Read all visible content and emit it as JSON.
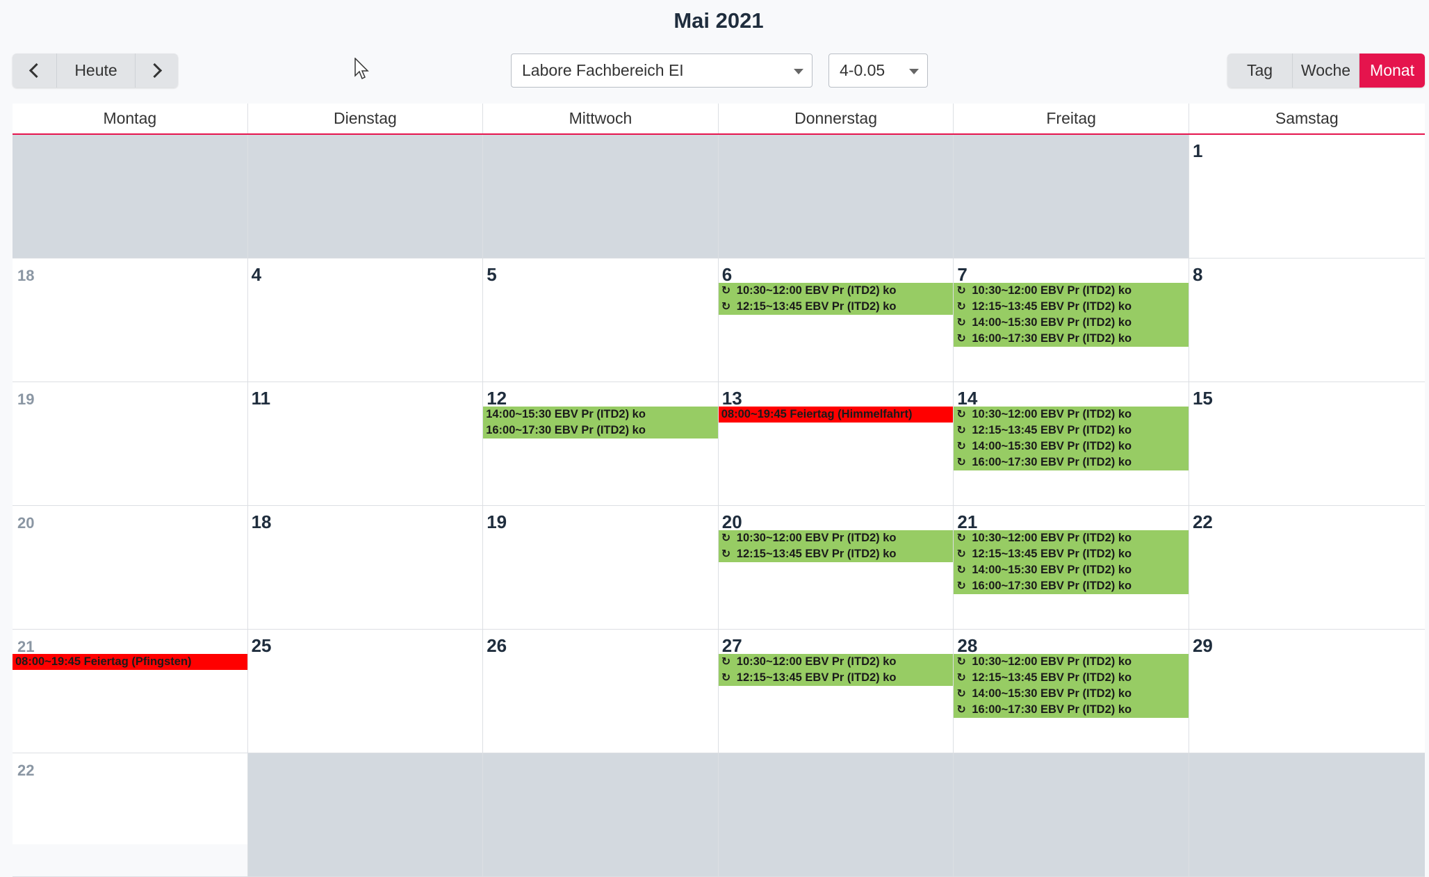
{
  "title": "Mai 2021",
  "nav": {
    "prev_icon": "chevron-left-icon",
    "today_label": "Heute",
    "next_icon": "chevron-right-icon"
  },
  "filters": {
    "group_value": "Labore Fachbereich EI",
    "room_value": "4-0.05"
  },
  "views": {
    "day": "Tag",
    "week": "Woche",
    "month": "Monat",
    "active": "Monat"
  },
  "colors": {
    "accent": "#e5144d",
    "event_green": "#97cc64",
    "event_red": "#ff0000",
    "outside_day": "#d3d9df"
  },
  "weekdays": [
    "Montag",
    "Dienstag",
    "Mittwoch",
    "Donnerstag",
    "Freitag",
    "Samstag"
  ],
  "weeks": [
    {
      "cells": [
        {
          "label": "",
          "outside": true,
          "events": []
        },
        {
          "label": "",
          "outside": true,
          "events": []
        },
        {
          "label": "",
          "outside": true,
          "events": []
        },
        {
          "label": "",
          "outside": true,
          "events": []
        },
        {
          "label": "",
          "outside": true,
          "events": []
        },
        {
          "label": "1",
          "outside": false,
          "events": []
        }
      ]
    },
    {
      "cells": [
        {
          "label": "18",
          "kw": true,
          "outside": false,
          "events": []
        },
        {
          "label": "4",
          "outside": false,
          "events": []
        },
        {
          "label": "5",
          "outside": false,
          "events": []
        },
        {
          "label": "6",
          "outside": false,
          "events": [
            {
              "text": "10:30~12:00 EBV Pr (ITD2) ko",
              "color": "green",
              "recurring": true
            },
            {
              "text": "12:15~13:45 EBV Pr (ITD2) ko",
              "color": "green",
              "recurring": true
            }
          ]
        },
        {
          "label": "7",
          "outside": false,
          "events": [
            {
              "text": "10:30~12:00 EBV Pr (ITD2) ko",
              "color": "green",
              "recurring": true
            },
            {
              "text": "12:15~13:45 EBV Pr (ITD2) ko",
              "color": "green",
              "recurring": true
            },
            {
              "text": "14:00~15:30 EBV Pr (ITD2) ko",
              "color": "green",
              "recurring": true
            },
            {
              "text": "16:00~17:30 EBV Pr (ITD2) ko",
              "color": "green",
              "recurring": true
            }
          ]
        },
        {
          "label": "8",
          "outside": false,
          "events": []
        }
      ]
    },
    {
      "cells": [
        {
          "label": "19",
          "kw": true,
          "outside": false,
          "events": []
        },
        {
          "label": "11",
          "outside": false,
          "events": []
        },
        {
          "label": "12",
          "outside": false,
          "events": [
            {
              "text": "14:00~15:30 EBV Pr (ITD2) ko",
              "color": "green",
              "recurring": false
            },
            {
              "text": "16:00~17:30 EBV Pr (ITD2) ko",
              "color": "green",
              "recurring": false
            }
          ]
        },
        {
          "label": "13",
          "outside": false,
          "events": [
            {
              "text": "08:00~19:45 Feiertag (Himmelfahrt)",
              "color": "red",
              "recurring": false
            }
          ]
        },
        {
          "label": "14",
          "outside": false,
          "events": [
            {
              "text": "10:30~12:00 EBV Pr (ITD2) ko",
              "color": "green",
              "recurring": true
            },
            {
              "text": "12:15~13:45 EBV Pr (ITD2) ko",
              "color": "green",
              "recurring": true
            },
            {
              "text": "14:00~15:30 EBV Pr (ITD2) ko",
              "color": "green",
              "recurring": true
            },
            {
              "text": "16:00~17:30 EBV Pr (ITD2) ko",
              "color": "green",
              "recurring": true
            }
          ]
        },
        {
          "label": "15",
          "outside": false,
          "events": []
        }
      ]
    },
    {
      "cells": [
        {
          "label": "20",
          "kw": true,
          "outside": false,
          "events": []
        },
        {
          "label": "18",
          "outside": false,
          "events": []
        },
        {
          "label": "19",
          "outside": false,
          "events": []
        },
        {
          "label": "20",
          "outside": false,
          "events": [
            {
              "text": "10:30~12:00 EBV Pr (ITD2) ko",
              "color": "green",
              "recurring": true
            },
            {
              "text": "12:15~13:45 EBV Pr (ITD2) ko",
              "color": "green",
              "recurring": true
            }
          ]
        },
        {
          "label": "21",
          "outside": false,
          "events": [
            {
              "text": "10:30~12:00 EBV Pr (ITD2) ko",
              "color": "green",
              "recurring": true
            },
            {
              "text": "12:15~13:45 EBV Pr (ITD2) ko",
              "color": "green",
              "recurring": true
            },
            {
              "text": "14:00~15:30 EBV Pr (ITD2) ko",
              "color": "green",
              "recurring": true
            },
            {
              "text": "16:00~17:30 EBV Pr (ITD2) ko",
              "color": "green",
              "recurring": true
            }
          ]
        },
        {
          "label": "22",
          "outside": false,
          "events": []
        }
      ]
    },
    {
      "cells": [
        {
          "label": "21",
          "kw": true,
          "outside": false,
          "events": [
            {
              "text": "08:00~19:45 Feiertag (Pfingsten)",
              "color": "red",
              "recurring": false
            }
          ]
        },
        {
          "label": "25",
          "outside": false,
          "events": []
        },
        {
          "label": "26",
          "outside": false,
          "events": []
        },
        {
          "label": "27",
          "outside": false,
          "events": [
            {
              "text": "10:30~12:00 EBV Pr (ITD2) ko",
              "color": "green",
              "recurring": true
            },
            {
              "text": "12:15~13:45 EBV Pr (ITD2) ko",
              "color": "green",
              "recurring": true
            }
          ]
        },
        {
          "label": "28",
          "outside": false,
          "events": [
            {
              "text": "10:30~12:00 EBV Pr (ITD2) ko",
              "color": "green",
              "recurring": true
            },
            {
              "text": "12:15~13:45 EBV Pr (ITD2) ko",
              "color": "green",
              "recurring": true
            },
            {
              "text": "14:00~15:30 EBV Pr (ITD2) ko",
              "color": "green",
              "recurring": true
            },
            {
              "text": "16:00~17:30 EBV Pr (ITD2) ko",
              "color": "green",
              "recurring": true
            }
          ]
        },
        {
          "label": "29",
          "outside": false,
          "events": []
        }
      ]
    },
    {
      "cells": [
        {
          "label": "22",
          "kw": true,
          "outside": false,
          "events": []
        },
        {
          "label": "",
          "outside": true,
          "events": []
        },
        {
          "label": "",
          "outside": true,
          "events": []
        },
        {
          "label": "",
          "outside": true,
          "events": []
        },
        {
          "label": "",
          "outside": true,
          "events": []
        },
        {
          "label": "",
          "outside": true,
          "events": []
        }
      ]
    }
  ],
  "recurring_icon": "↻"
}
